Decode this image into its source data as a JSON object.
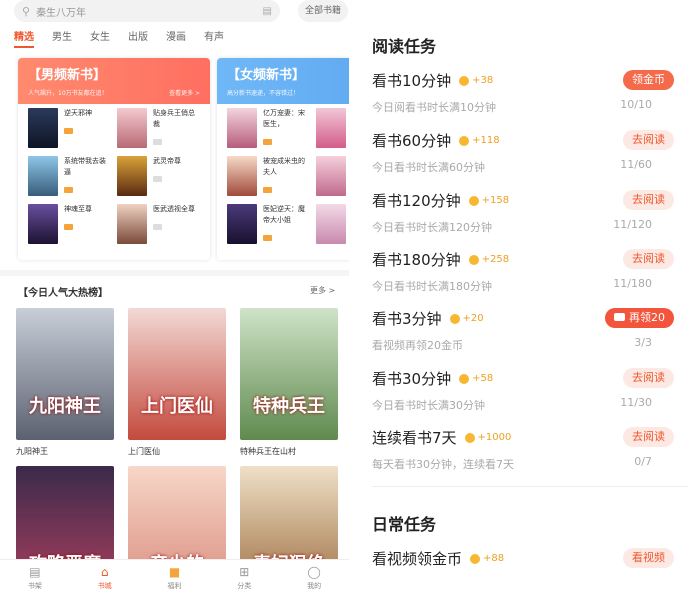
{
  "search": {
    "placeholder": "秦生八万年",
    "all_books": "全部书籍"
  },
  "tabs": [
    "精选",
    "男生",
    "女生",
    "出版",
    "漫画",
    "有声"
  ],
  "promo_male": {
    "title": "【男频新书】",
    "subtitle": "人气飙升，10万书友都在追！",
    "more": "查看更多 >",
    "books": [
      "逆天邪神",
      "贴身兵王俏总裁",
      "系统带我去装逼",
      "武灵帝尊",
      "神魂至尊",
      "医武透视全尊"
    ]
  },
  "promo_female": {
    "title": "【女频新书】",
    "subtitle": "高分新书速递，不容错过！",
    "books": [
      "亿万宠妻：宋医生，",
      "",
      "被宠成米虫的夫人",
      "",
      "医妃逆天：魔帝大小姐",
      ""
    ]
  },
  "hot": {
    "title": "【今日人气大热榜】",
    "more": "更多 >",
    "books": [
      {
        "name": "九阳神王",
        "cover_text": "九阳神王",
        "colors": [
          "#c9cfd8",
          "#5b6170"
        ]
      },
      {
        "name": "上门医仙",
        "cover_text": "上门医仙",
        "colors": [
          "#f2d9d4",
          "#c44a3e"
        ]
      },
      {
        "name": "特种兵王在山村",
        "cover_text": "特种兵王",
        "colors": [
          "#cfe3c8",
          "#5f8a4e"
        ]
      },
      {
        "name": "",
        "cover_text": "攻略恶魔",
        "colors": [
          "#3a2a4a",
          "#b04060"
        ]
      },
      {
        "name": "",
        "cover_text": "帝少的",
        "colors": [
          "#f7d7c8",
          "#d88a7c"
        ]
      },
      {
        "name": "",
        "cover_text": "毒妃狠绝",
        "colors": [
          "#efe0c6",
          "#9b6b3e"
        ]
      }
    ]
  },
  "nav": [
    "书架",
    "书城",
    "福利",
    "分类",
    "我的"
  ],
  "reading_tasks_title": "阅读任务",
  "tasks": [
    {
      "name": "看书10分钟",
      "reward": "+38",
      "desc": "今日阅看书时长满10分钟",
      "button": "领金币",
      "progress": "10/10",
      "kind": "claim"
    },
    {
      "name": "看书60分钟",
      "reward": "+118",
      "desc": "今日看书时长满60分钟",
      "button": "去阅读",
      "progress": "11/60",
      "kind": "go"
    },
    {
      "name": "看书120分钟",
      "reward": "+158",
      "desc": "今日看书时长满120分钟",
      "button": "去阅读",
      "progress": "11/120",
      "kind": "go"
    },
    {
      "name": "看书180分钟",
      "reward": "+258",
      "desc": "今日看书时长满180分钟",
      "button": "去阅读",
      "progress": "11/180",
      "kind": "go"
    },
    {
      "name": "看书3分钟",
      "reward": "+20",
      "desc": "看视频再领20金币",
      "button": "再领20",
      "progress": "3/3",
      "kind": "video"
    },
    {
      "name": "看书30分钟",
      "reward": "+58",
      "desc": "今日看书时长满30分钟",
      "button": "去阅读",
      "progress": "11/30",
      "kind": "go"
    },
    {
      "name": "连续看书7天",
      "reward": "+1000",
      "desc": "每天看书30分钟，连续看7天",
      "button": "去阅读",
      "progress": "0/7",
      "kind": "go"
    }
  ],
  "daily_tasks_title": "日常任务",
  "daily_task": {
    "name": "看视频领金币",
    "reward": "+88",
    "button": "看视频"
  },
  "colors": {
    "accent": "#f0572d",
    "male_header": "#ff7a66",
    "female_header": "#66b0f4",
    "coin": "#f7b731"
  }
}
